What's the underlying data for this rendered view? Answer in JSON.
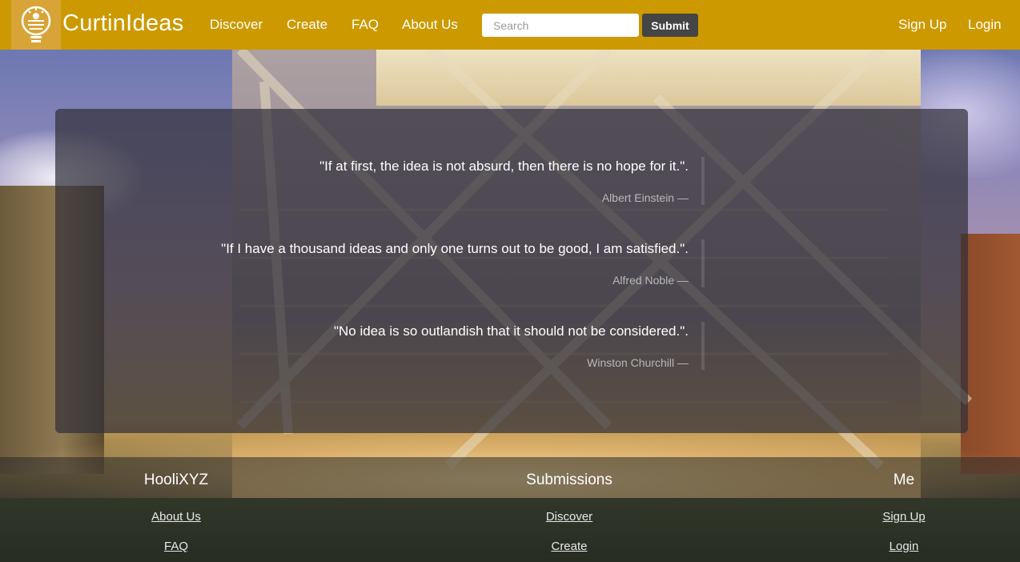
{
  "navbar": {
    "brand": "CurtinIdeas",
    "logo_icon": "lightbulb-icon",
    "links": [
      "Discover",
      "Create",
      "FAQ",
      "About Us"
    ],
    "search_placeholder": "Search",
    "search_value": "",
    "submit_label": "Submit",
    "right_links": [
      "Sign Up",
      "Login"
    ]
  },
  "quotes": [
    {
      "text": "\"If at first, the idea is not absurd, then there is no hope for it.\".",
      "author": "Albert Einstein —"
    },
    {
      "text": "\"If I have a thousand ideas and only one turns out to be good, I am satisfied.\".",
      "author": "Alfred Noble —"
    },
    {
      "text": "\"No idea is so outlandish that it should not be considered.\".",
      "author": "Winston Churchill —"
    }
  ],
  "footer": {
    "columns": [
      {
        "heading": "HooliXYZ",
        "links": [
          "About Us",
          "FAQ"
        ]
      },
      {
        "heading": "Submissions",
        "links": [
          "Discover",
          "Create"
        ]
      },
      {
        "heading": "Me",
        "links": [
          "Sign Up",
          "Login"
        ]
      }
    ]
  },
  "colors": {
    "navbar": "#cc9900",
    "submit_button": "#454545",
    "panel": "rgba(50,48,58,0.72)"
  }
}
